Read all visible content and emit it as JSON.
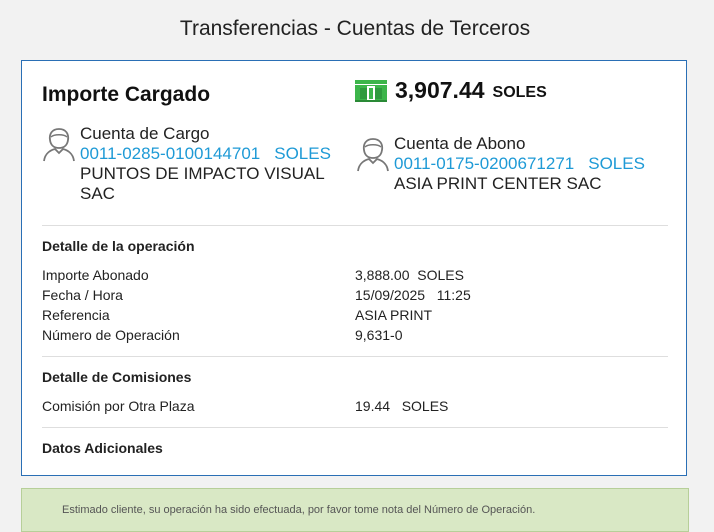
{
  "page": {
    "title": "Transferencias - Cuentas de Terceros"
  },
  "summary": {
    "importe_label": "Importe Cargado",
    "amount": "3,907.44",
    "currency": "SOLES",
    "amount_icon": "money-bills-icon"
  },
  "cargo": {
    "label": "Cuenta de Cargo",
    "account_number": "0011-0285-0100144701",
    "currency": "SOLES",
    "holder": "PUNTOS DE IMPACTO VISUAL SAC",
    "icon": "user-icon"
  },
  "abono": {
    "label": "Cuenta de Abono",
    "account_number": "0011-0175-0200671271",
    "currency": "SOLES",
    "holder": "ASIA PRINT CENTER SAC",
    "icon": "user-icon"
  },
  "operation": {
    "title": "Detalle de la operación",
    "rows": [
      {
        "label": "Importe Abonado",
        "value": "3,888.00  SOLES"
      },
      {
        "label": "Fecha / Hora",
        "value": "15/09/2025   11:25"
      },
      {
        "label": "Referencia",
        "value": "ASIA PRINT"
      },
      {
        "label": "Número de Operación",
        "value": "9,631-0"
      }
    ]
  },
  "commissions": {
    "title": "Detalle de Comisiones",
    "rows": [
      {
        "label": "Comisión por Otra Plaza",
        "value": "19.44   SOLES"
      }
    ]
  },
  "additional": {
    "title": "Datos Adicionales"
  },
  "notice": {
    "text": "Estimado cliente, su operación ha sido efectuada, por favor tome nota del Número de Operación."
  },
  "colors": {
    "link_blue": "#1e9ad6",
    "card_border": "#2a6fb5",
    "notice_bg": "#d9e8c5",
    "money_green": "#3cb54a"
  }
}
